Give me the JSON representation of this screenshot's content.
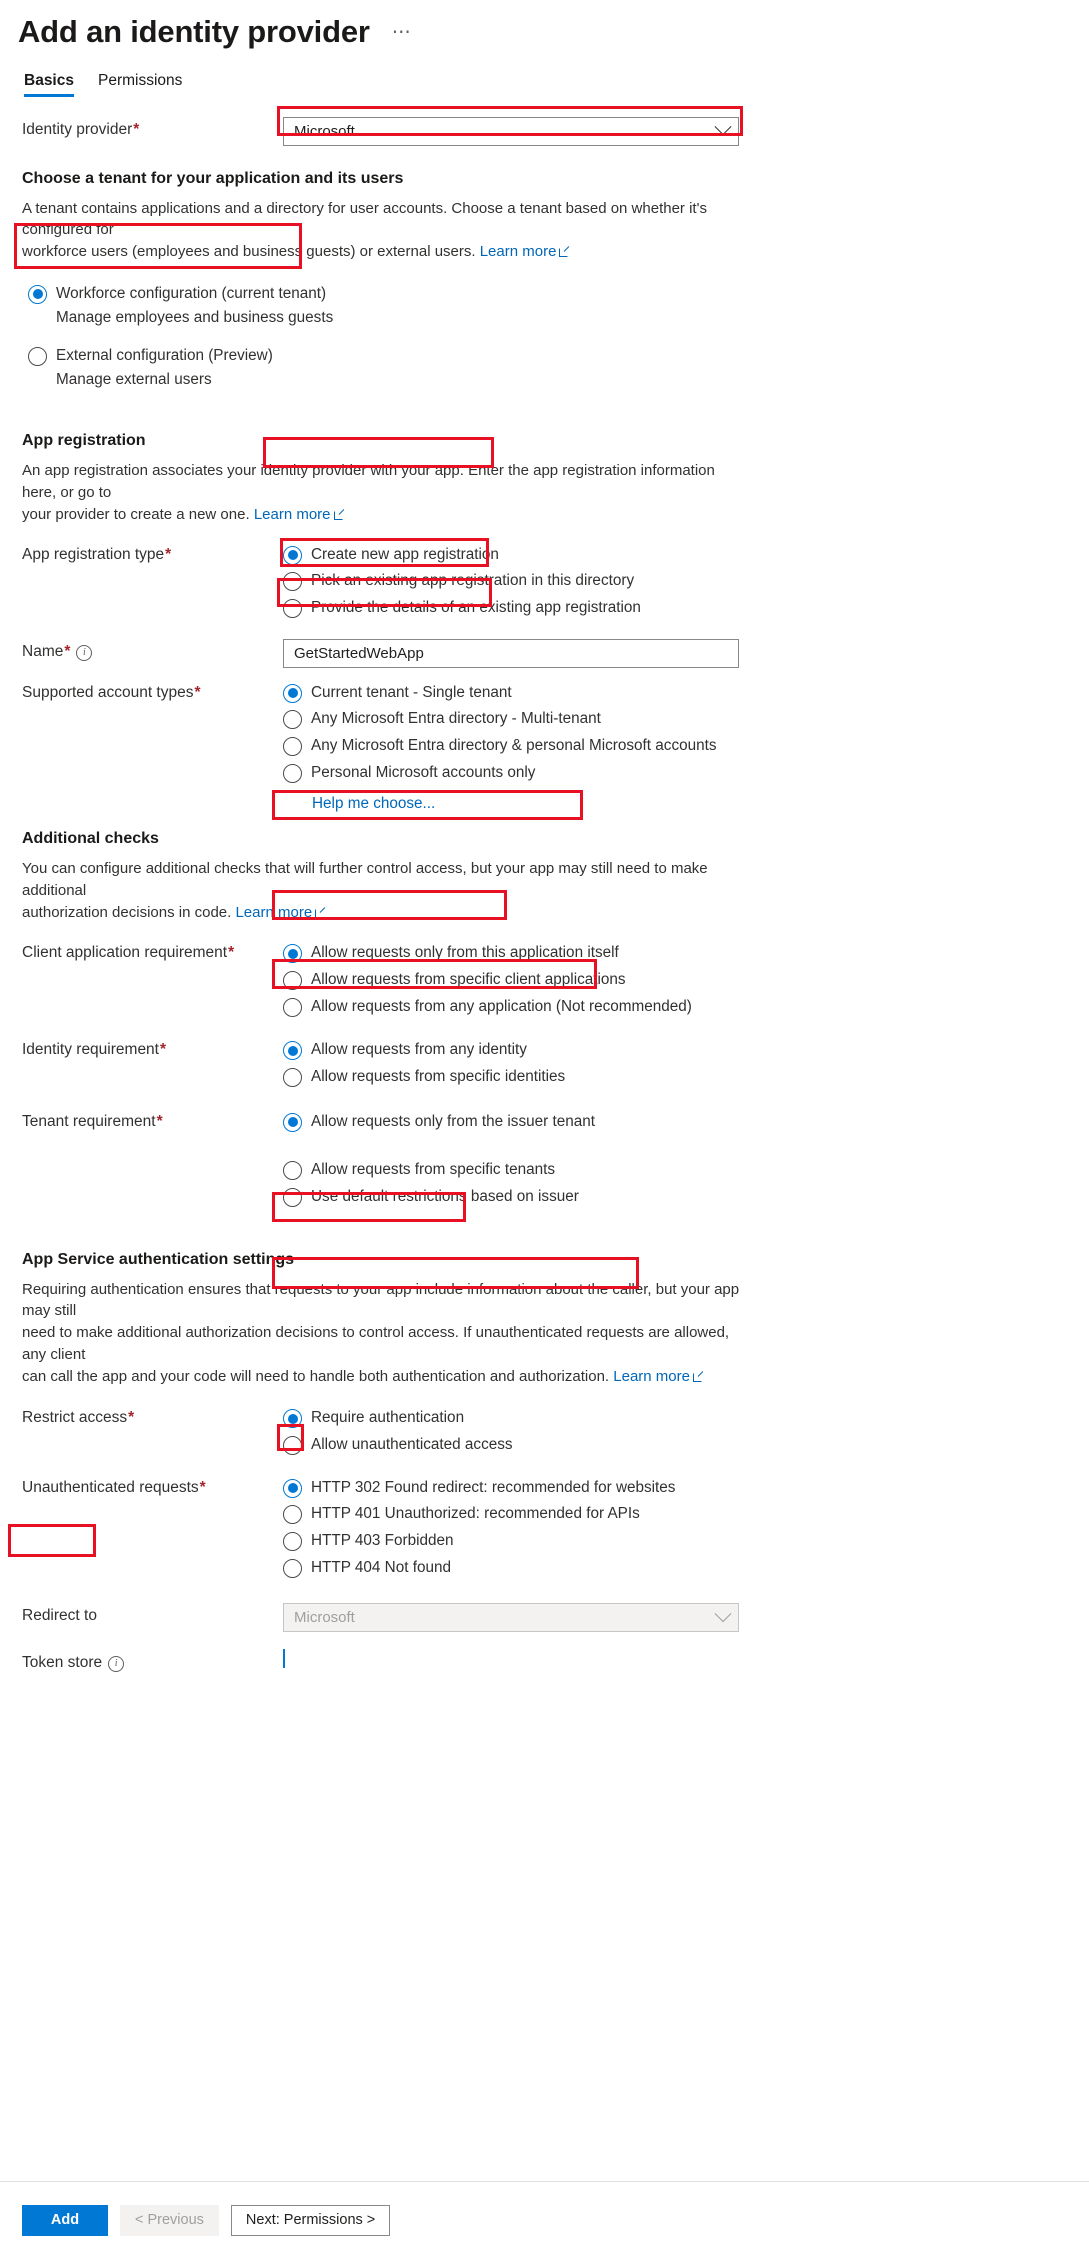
{
  "header": {
    "title": "Add an identity provider",
    "more_label": "⋯"
  },
  "tabs": [
    {
      "label": "Basics",
      "active": true
    },
    {
      "label": "Permissions",
      "active": false
    }
  ],
  "identity_provider": {
    "label": "Identity provider",
    "required": "*",
    "value": "Microsoft"
  },
  "tenant_section": {
    "heading": "Choose a tenant for your application and its users",
    "description_1": "A tenant contains applications and a directory for user accounts. Choose a tenant based on whether it's configured for",
    "description_2": "workforce users (employees and business guests) or external users.",
    "learn_more": "Learn more",
    "options": [
      {
        "label": "Workforce configuration (current tenant)",
        "sub": "Manage employees and business guests",
        "checked": true
      },
      {
        "label": "External configuration (Preview)",
        "sub": "Manage external users",
        "checked": false
      }
    ]
  },
  "app_registration": {
    "heading": "App registration",
    "description_1": "An app registration associates your identity provider with your app. Enter the app registration information here, or go to",
    "description_2": "your provider to create a new one.",
    "learn_more": "Learn more",
    "type_label": "App registration type",
    "type_required": "*",
    "type_options": [
      {
        "label": "Create new app registration",
        "checked": true
      },
      {
        "label": "Pick an existing app registration in this directory",
        "checked": false
      },
      {
        "label": "Provide the details of an existing app registration",
        "checked": false
      }
    ],
    "name_label": "Name",
    "name_required": "*",
    "name_value": "GetStartedWebApp",
    "account_types_label": "Supported account types",
    "account_types_required": "*",
    "account_types_options": [
      {
        "label": "Current tenant - Single tenant",
        "checked": true
      },
      {
        "label": "Any Microsoft Entra directory - Multi-tenant",
        "checked": false
      },
      {
        "label": "Any Microsoft Entra directory & personal Microsoft accounts",
        "checked": false
      },
      {
        "label": "Personal Microsoft accounts only",
        "checked": false
      }
    ],
    "help_me_choose": "Help me choose..."
  },
  "additional_checks": {
    "heading": "Additional checks",
    "description_1": "You can configure additional checks that will further control access, but your app may still need to make additional",
    "description_2": "authorization decisions in code.",
    "learn_more": "Learn more",
    "client_app_label": "Client application requirement",
    "client_app_required": "*",
    "client_app_options": [
      {
        "label": "Allow requests only from this application itself",
        "checked": true
      },
      {
        "label": "Allow requests from specific client applications",
        "checked": false
      },
      {
        "label": "Allow requests from any application (Not recommended)",
        "checked": false
      }
    ],
    "identity_label": "Identity requirement",
    "identity_required": "*",
    "identity_options": [
      {
        "label": "Allow requests from any identity",
        "checked": true
      },
      {
        "label": "Allow requests from specific identities",
        "checked": false
      }
    ],
    "tenant_label": "Tenant requirement",
    "tenant_required": "*",
    "tenant_options": [
      {
        "label": "Allow requests only from the issuer tenant",
        "checked": true
      },
      {
        "label": "Allow requests from specific tenants",
        "checked": false
      },
      {
        "label": "Use default restrictions based on issuer",
        "checked": false
      }
    ]
  },
  "auth_settings": {
    "heading": "App Service authentication settings",
    "description_1": "Requiring authentication ensures that requests to your app include information about the caller, but your app may still",
    "description_2": "need to make additional authorization decisions to control access. If unauthenticated requests are allowed, any client",
    "description_3": "can call the app and your code will need to handle both authentication and authorization.",
    "learn_more": "Learn more",
    "restrict_label": "Restrict access",
    "restrict_required": "*",
    "restrict_options": [
      {
        "label": "Require authentication",
        "checked": true
      },
      {
        "label": "Allow unauthenticated access",
        "checked": false
      }
    ],
    "unauth_label": "Unauthenticated requests",
    "unauth_required": "*",
    "unauth_options": [
      {
        "label": "HTTP 302 Found redirect: recommended for websites",
        "checked": true
      },
      {
        "label": "HTTP 401 Unauthorized: recommended for APIs",
        "checked": false
      },
      {
        "label": "HTTP 403 Forbidden",
        "checked": false
      },
      {
        "label": "HTTP 404 Not found",
        "checked": false
      }
    ],
    "redirect_label": "Redirect to",
    "redirect_value": "Microsoft",
    "token_store_label": "Token store",
    "token_store_checked": true
  },
  "footer": {
    "add_label": "Add",
    "previous_label": "< Previous",
    "next_label": "Next: Permissions >"
  },
  "colors": {
    "accent": "#0078d4",
    "link": "#0067b8",
    "annotation": "#e81123",
    "required": "#a4262c"
  }
}
